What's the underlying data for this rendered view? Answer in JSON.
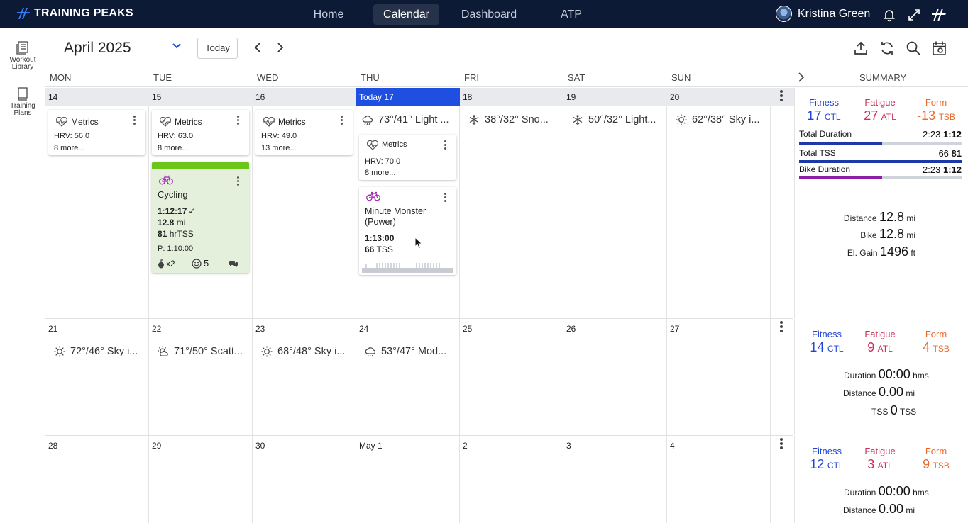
{
  "brand": {
    "name": "TRAINING PEAKS"
  },
  "nav": {
    "home": "Home",
    "calendar": "Calendar",
    "dashboard": "Dashboard",
    "atp": "ATP"
  },
  "user": {
    "name": "Kristina Green"
  },
  "sidebar": {
    "workout_library": [
      "Workout",
      "Library"
    ],
    "training_plans": [
      "Training",
      "Plans"
    ]
  },
  "toolbar": {
    "month": "April 2025",
    "today": "Today"
  },
  "days": [
    "MON",
    "TUE",
    "WED",
    "THU",
    "FRI",
    "SAT",
    "SUN"
  ],
  "summary_label": "SUMMARY",
  "week1": {
    "dates": [
      "14",
      "15",
      "16",
      "Today 17",
      "18",
      "19",
      "20"
    ],
    "metrics": [
      {
        "title": "Metrics",
        "hrv": "HRV: 56.0",
        "more": "8 more..."
      },
      {
        "title": "Metrics",
        "hrv": "HRV: 63.0",
        "more": "8 more..."
      },
      {
        "title": "Metrics",
        "hrv": "HRV: 49.0",
        "more": "13 more..."
      },
      {
        "title": "Metrics",
        "hrv": "HRV: 70.0",
        "more": "8 more..."
      }
    ],
    "weather": {
      "thu": "73°/41° Light ...",
      "fri": "38°/32° Sno...",
      "sat": "50°/32° Light...",
      "sun": "62°/38° Sky i..."
    },
    "cycling": {
      "title": "Cycling",
      "duration": "1:12:17",
      "distance": "12.8",
      "distance_unit": "mi",
      "tss": "81",
      "tss_unit": "hrTSS",
      "planned": "P: 1:10:00",
      "likes": "x2",
      "feel": "5"
    },
    "minute_monster": {
      "title_1": "Minute Monster",
      "title_2": "(Power)",
      "duration": "1:13:00",
      "tss": "66",
      "tss_unit": "TSS"
    }
  },
  "summary1": {
    "fitness_label": "Fitness",
    "fitness": "17",
    "fitness_unit": "CTL",
    "fatigue_label": "Fatigue",
    "fatigue": "27",
    "fatigue_unit": "ATL",
    "form_label": "Form",
    "form": "-13",
    "form_unit": "TSB",
    "total_duration_label": "Total Duration",
    "total_duration_planned": "2:23",
    "total_duration_done": "1:12",
    "total_tss_label": "Total TSS",
    "total_tss_planned": "66",
    "total_tss_done": "81",
    "bike_duration_label": "Bike Duration",
    "bike_duration_planned": "2:23",
    "bike_duration_done": "1:12",
    "distance_label": "Distance",
    "distance": "12.8",
    "distance_unit": "mi",
    "bike_label": "Bike",
    "bike": "12.8",
    "bike_unit": "mi",
    "gain_label": "El. Gain",
    "gain": "1496",
    "gain_unit": "ft",
    "total_duration_progress": 0.51,
    "total_tss_progress": 1.0,
    "bike_duration_progress": 0.51
  },
  "week2": {
    "dates": [
      "21",
      "22",
      "23",
      "24",
      "25",
      "26",
      "27"
    ],
    "weather": {
      "mon": "72°/46° Sky i...",
      "tue": "71°/50° Scatt...",
      "wed": "68°/48° Sky i...",
      "thu": "53°/47° Mod..."
    }
  },
  "summary2": {
    "fitness_label": "Fitness",
    "fitness": "14",
    "fitness_unit": "CTL",
    "fatigue_label": "Fatigue",
    "fatigue": "9",
    "fatigue_unit": "ATL",
    "form_label": "Form",
    "form": "4",
    "form_unit": "TSB",
    "duration_label": "Duration",
    "duration": "00:00",
    "duration_unit": "hms",
    "distance_label": "Distance",
    "distance": "0.00",
    "distance_unit": "mi",
    "tss_label": "TSS",
    "tss": "0",
    "tss_unit": "TSS"
  },
  "week3": {
    "dates": [
      "28",
      "29",
      "30",
      "May 1",
      "2",
      "3",
      "4"
    ]
  },
  "summary3": {
    "fitness_label": "Fitness",
    "fitness": "12",
    "fitness_unit": "CTL",
    "fatigue_label": "Fatigue",
    "fatigue": "3",
    "fatigue_unit": "ATL",
    "form_label": "Form",
    "form": "9",
    "form_unit": "TSB",
    "duration_label": "Duration",
    "duration": "00:00",
    "duration_unit": "hms",
    "distance_label": "Distance",
    "distance": "0.00",
    "distance_unit": "mi"
  },
  "colors": {
    "navy": "#0c1a36",
    "today": "#1f4fe0",
    "fitness": "#2346d2",
    "fatigue": "#cc2e58",
    "form": "#ea6a2c",
    "cycling": "#e4efdc",
    "cycling_bar": "#6cc61a",
    "bike_icon": "#a02ab0"
  }
}
